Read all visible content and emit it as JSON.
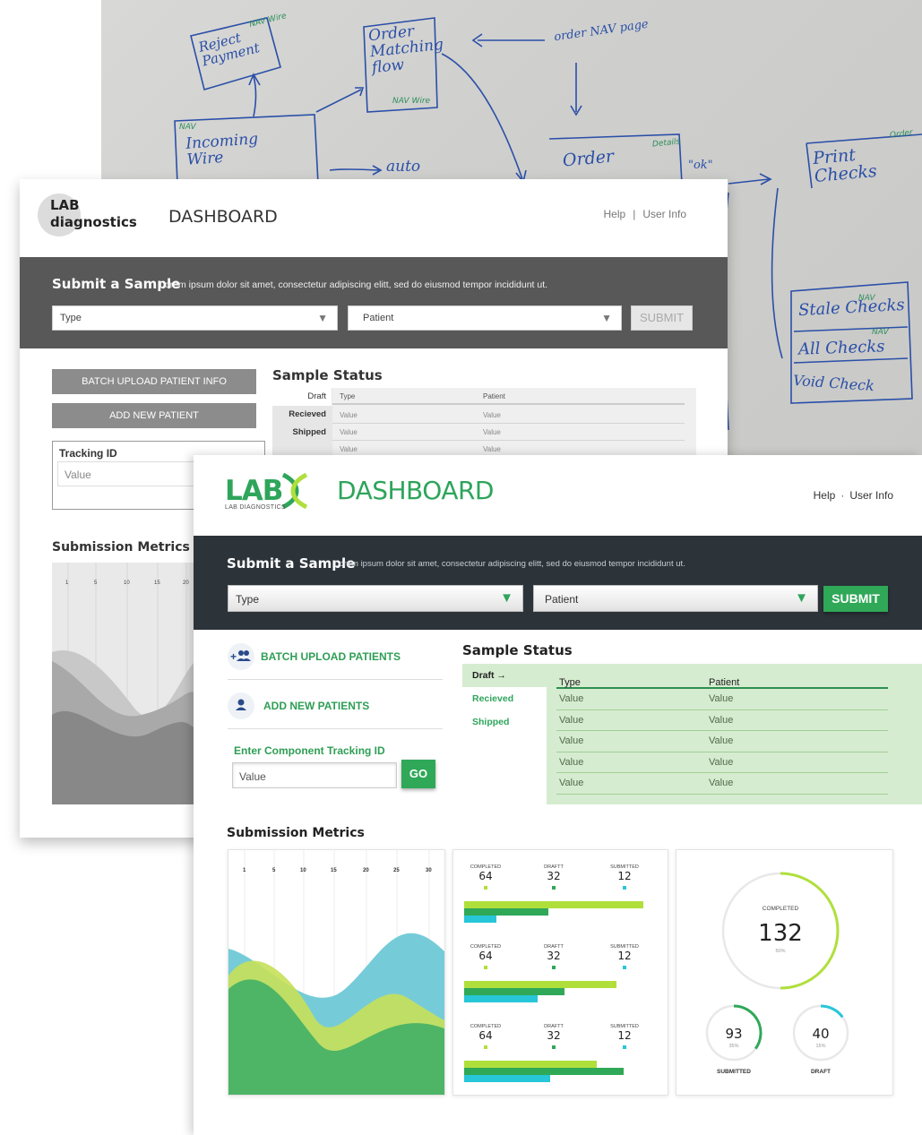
{
  "whiteboard": {
    "notes": [
      {
        "text": "Reject\nPayment"
      },
      {
        "text": "Order\nMatching\nflow"
      },
      {
        "text": "Incoming\nWire"
      },
      {
        "text": "auto"
      },
      {
        "text": "order NAV page"
      },
      {
        "text": "Order"
      },
      {
        "text": "\"ok\""
      },
      {
        "text": "Print\nChecks"
      },
      {
        "text": "Stale Checks"
      },
      {
        "text": "All Checks"
      },
      {
        "text": "Void Check"
      }
    ],
    "tags": [
      "NAV\nWire",
      "NAV\nWire",
      "NAV",
      "Details",
      "Order",
      "NAV",
      "NAV"
    ]
  },
  "wireframe": {
    "logo": "LAB\ndiagnostics",
    "title": "DASHBOARD",
    "links": {
      "help": "Help",
      "separator": "|",
      "user": "User Info"
    },
    "submit_section": {
      "title": "Submit a Sample",
      "description": "Lorem ipsum dolor sit amet, consectetur adipiscing elitt, sed do eiusmod tempor incididunt ut.",
      "type_select": "Type",
      "patient_select": "Patient",
      "submit_label": "SUBMIT"
    },
    "batch_button": "BATCH UPLOAD PATIENT INFO",
    "add_button": "ADD NEW PATIENT",
    "tracking": {
      "label": "Tracking ID",
      "value": "Value"
    },
    "status": {
      "title": "Sample Status",
      "tabs": [
        "Draft",
        "Recieved",
        "Shipped"
      ],
      "columns": [
        "Type",
        "Patient"
      ],
      "rows": [
        [
          "Value",
          "Value"
        ],
        [
          "Value",
          "Value"
        ],
        [
          "Value",
          "Value"
        ]
      ]
    },
    "metrics_title": "Submission Metrics",
    "chart_ticks": [
      "1",
      "5",
      "10",
      "15",
      "20"
    ]
  },
  "final": {
    "logo": {
      "name": "LAB",
      "subtitle": "LAB DIAGNOSTICS"
    },
    "title": "DASHBOARD",
    "links": {
      "help": "Help",
      "separator": "·",
      "user": "User Info"
    },
    "submit_section": {
      "title": "Submit a Sample",
      "description": "Lorem ipsum dolor sit amet, consectetur adipiscing elitt, sed do eiusmod tempor incididunt ut.",
      "type_select": "Type",
      "patient_select": "Patient",
      "submit_label": "SUBMIT"
    },
    "actions": {
      "batch": {
        "label": "BATCH UPLOAD PATIENTS",
        "icon": "add-users-icon"
      },
      "add": {
        "label": "ADD NEW PATIENTS",
        "icon": "user-icon"
      }
    },
    "tracking": {
      "label": "Enter Component Tracking ID",
      "value": "Value",
      "go_label": "GO"
    },
    "status": {
      "title": "Sample Status",
      "tabs": [
        "Draft →",
        "Recieved",
        "Shipped"
      ],
      "selected_tab": "Draft →",
      "columns": [
        "Type",
        "Patient"
      ],
      "rows": [
        [
          "Value",
          "Value"
        ],
        [
          "Value",
          "Value"
        ],
        [
          "Value",
          "Value"
        ],
        [
          "Value",
          "Value"
        ],
        [
          "Value",
          "Value"
        ]
      ]
    },
    "metrics_title": "Submission Metrics",
    "colors": {
      "brand": "#2ea55b",
      "lime": "#b0df3c",
      "green": "#2fa858",
      "cyan": "#27c6d8",
      "teal": "#6ec9d6",
      "band": "#2c343a"
    }
  },
  "chart_data": [
    {
      "type": "area",
      "title": "",
      "x_ticks": [
        "1",
        "5",
        "10",
        "15",
        "20",
        "25",
        "30"
      ],
      "series": []
    },
    {
      "type": "bar",
      "groups": [
        {
          "legend": [
            {
              "label": "COMPLETED",
              "value": 64
            },
            {
              "label": "DRAFTT",
              "value": 32
            },
            {
              "label": "SUBMITTED",
              "value": 12
            }
          ],
          "bars": [
            100,
            47,
            18
          ]
        },
        {
          "legend": [
            {
              "label": "COMPLETED",
              "value": 64
            },
            {
              "label": "DRAFTT",
              "value": 32
            },
            {
              "label": "SUBMITTED",
              "value": 12
            }
          ],
          "bars": [
            85,
            56,
            41
          ]
        },
        {
          "legend": [
            {
              "label": "COMPLETED",
              "value": 64
            },
            {
              "label": "DRAFTT",
              "value": 32
            },
            {
              "label": "SUBMITTED",
              "value": 12
            }
          ],
          "bars": [
            74,
            89,
            48
          ]
        }
      ]
    },
    {
      "type": "pie",
      "rings": [
        {
          "label": "COMPLETED",
          "value": 132,
          "percent": "50%",
          "fraction": 0.5
        },
        {
          "label": "SUBMITTED",
          "value": 93,
          "percent": "35%",
          "fraction": 0.35
        },
        {
          "label": "DRAFT",
          "value": 40,
          "percent": "15%",
          "fraction": 0.15
        }
      ]
    }
  ]
}
